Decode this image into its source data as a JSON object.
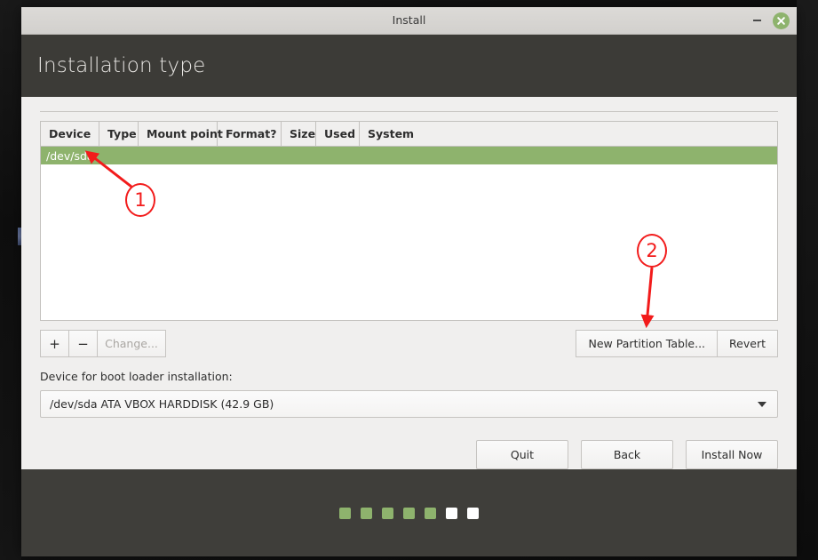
{
  "window": {
    "title": "Install",
    "minimize_icon": "minimize-icon",
    "close_icon": "close-icon"
  },
  "header": {
    "page_title": "Installation type"
  },
  "partition_table": {
    "columns": [
      "Device",
      "Type",
      "Mount point",
      "Format?",
      "Size",
      "Used",
      "System"
    ],
    "rows": [
      {
        "device": "/dev/sda",
        "type": "",
        "mount_point": "",
        "format": "",
        "size": "",
        "used": "",
        "system": "",
        "selected": true
      }
    ]
  },
  "actions": {
    "add_label": "+",
    "remove_label": "−",
    "change_label": "Change...",
    "change_disabled": true,
    "new_partition_table_label": "New Partition Table...",
    "revert_label": "Revert"
  },
  "bootloader": {
    "label": "Device for boot loader installation:",
    "selected_value": "/dev/sda ATA VBOX HARDDISK (42.9 GB)",
    "dropdown_icon": "chevron-down-icon"
  },
  "navigation": {
    "quit_label": "Quit",
    "back_label": "Back",
    "install_now_label": "Install Now"
  },
  "progress": {
    "total_steps": 7,
    "completed_steps": 5,
    "done_color": "#8eb36d",
    "todo_color": "#ffffff"
  },
  "annotations": [
    {
      "number": "1",
      "target": "/dev/sda table row"
    },
    {
      "number": "2",
      "target": "New Partition Table... button"
    }
  ],
  "colors": {
    "accent_green": "#8eb36d",
    "header_dark": "#3c3b37",
    "footer_dark": "#3f3e3a",
    "annotation_red": "#f21b1b"
  }
}
